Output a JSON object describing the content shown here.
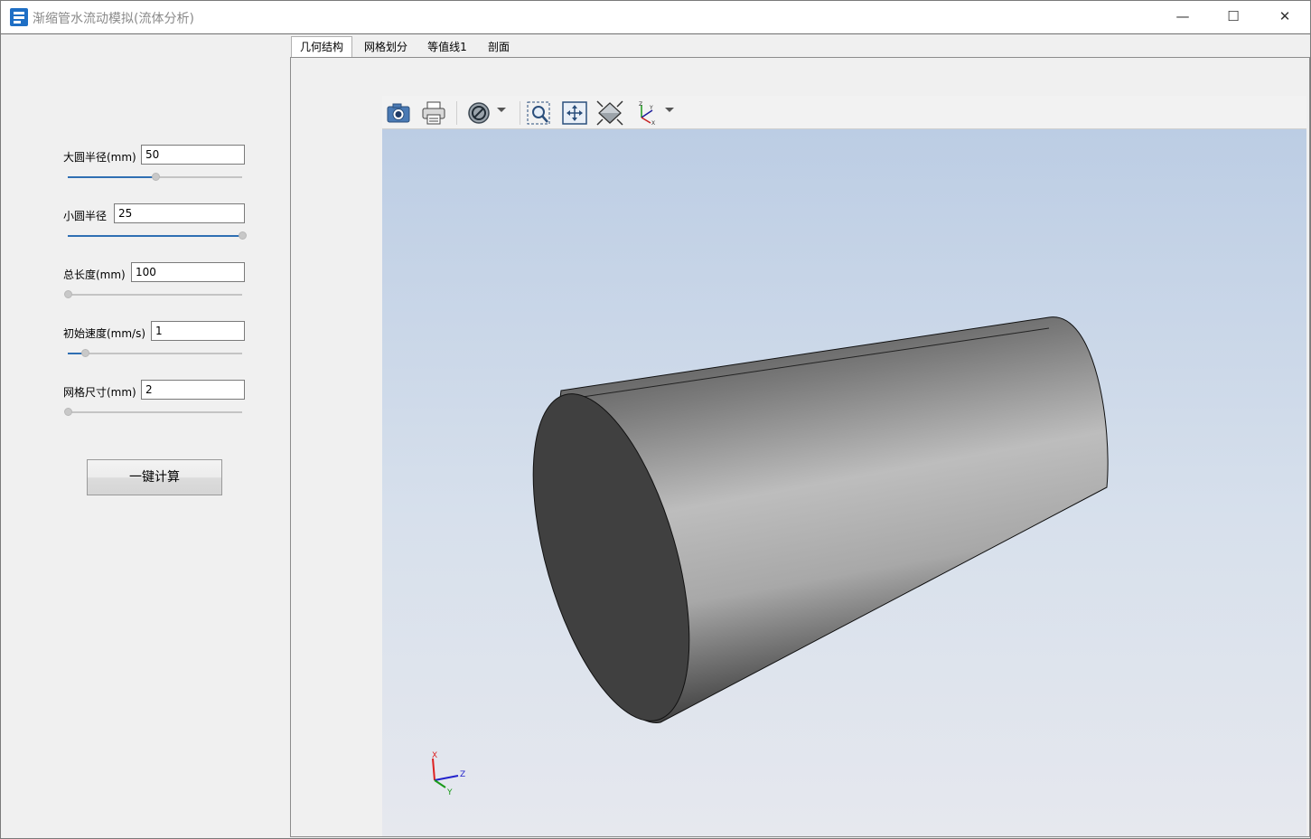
{
  "window": {
    "title": "渐缩管水流动模拟(流体分析)",
    "controls": {
      "minimize": "—",
      "maximize": "☐",
      "close": "✕"
    }
  },
  "params": {
    "big_radius": {
      "label": "大圆半径(mm)",
      "value": "50",
      "slider_fraction": 0.5
    },
    "small_radius": {
      "label": "小圆半径",
      "value": "25",
      "slider_fraction": 1.0
    },
    "total_length": {
      "label": "总长度(mm)",
      "value": "100",
      "slider_fraction": 0.0
    },
    "init_speed": {
      "label": "初始速度(mm/s)",
      "value": "1",
      "slider_fraction": 0.1
    },
    "mesh_size": {
      "label": "网格尺寸(mm)",
      "value": "2",
      "slider_fraction": 0.0
    }
  },
  "calc_button": {
    "label": "一键计算"
  },
  "tabs": [
    {
      "label": "几何结构",
      "active": true
    },
    {
      "label": "网格划分",
      "active": false
    },
    {
      "label": "等值线1",
      "active": false
    },
    {
      "label": "剖面",
      "active": false
    }
  ],
  "toolbar": {
    "icons": [
      "camera-icon",
      "print-icon",
      "display-mode-icon",
      "zoom-window-icon",
      "fit-all-icon",
      "view-projection-icon",
      "axis-view-icon"
    ]
  },
  "axes_triad": {
    "x": "X",
    "y": "Y",
    "z": "Z"
  },
  "colors": {
    "accent": "#2f6fb3",
    "viewport_top": "#bccde4",
    "viewport_bottom": "#e6e8ee"
  }
}
